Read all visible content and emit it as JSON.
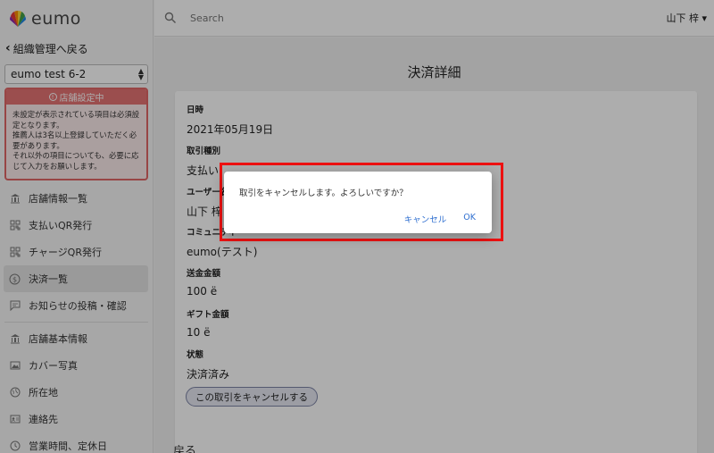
{
  "app": {
    "logo_text": "eumo",
    "colors": {
      "accent": "#2f6fd0",
      "warning": "#e57373",
      "highlight": "#ee1111"
    }
  },
  "sidebar": {
    "back_label": "組織管理へ戻る",
    "shop_select_value": "eumo test 6-2",
    "warning": {
      "title": "店舗設定中",
      "body": [
        "未設定が表示されている項目は必須設",
        "定となります。",
        "推薦人は3名以上登録していただく必",
        "要があります。",
        "それ以外の項目についても、必要に応",
        "じて入力をお願いします。"
      ]
    },
    "items": [
      {
        "label": "店舗情報一覧",
        "icon": "bank-icon"
      },
      {
        "label": "支払いQR発行",
        "icon": "qr-icon"
      },
      {
        "label": "チャージQR発行",
        "icon": "qr-icon"
      },
      {
        "label": "決済一覧",
        "icon": "dollar-icon"
      },
      {
        "label": "お知らせの投稿・確認",
        "icon": "message-icon"
      },
      {
        "label": "店舗基本情報",
        "icon": "bank-icon"
      },
      {
        "label": "カバー写真",
        "icon": "image-icon"
      },
      {
        "label": "所在地",
        "icon": "globe-icon"
      },
      {
        "label": "連絡先",
        "icon": "contact-card-icon"
      },
      {
        "label": "営業時間、定休日",
        "icon": "clock-icon"
      }
    ]
  },
  "topbar": {
    "search_placeholder": "Search",
    "user_name": "山下 梓 ▾"
  },
  "main": {
    "title": "決済詳細",
    "fields": [
      {
        "label": "日時",
        "value": "2021年05月19日"
      },
      {
        "label": "取引種別",
        "value": "支払い"
      },
      {
        "label": "ユーザー名",
        "value": "山下 梓"
      },
      {
        "label": "コミュニティ",
        "value": "eumo(テスト)"
      },
      {
        "label": "送金金額",
        "value": "100 ë"
      },
      {
        "label": "ギフト金額",
        "value": "10 ë"
      },
      {
        "label": "状態",
        "value": "決済済み"
      }
    ],
    "cancel_button": "この取引をキャンセルする",
    "back_link": "戻る"
  },
  "dialog": {
    "message": "取引をキャンセルします。よろしいですか？",
    "cancel": "キャンセル",
    "ok": "OK"
  }
}
